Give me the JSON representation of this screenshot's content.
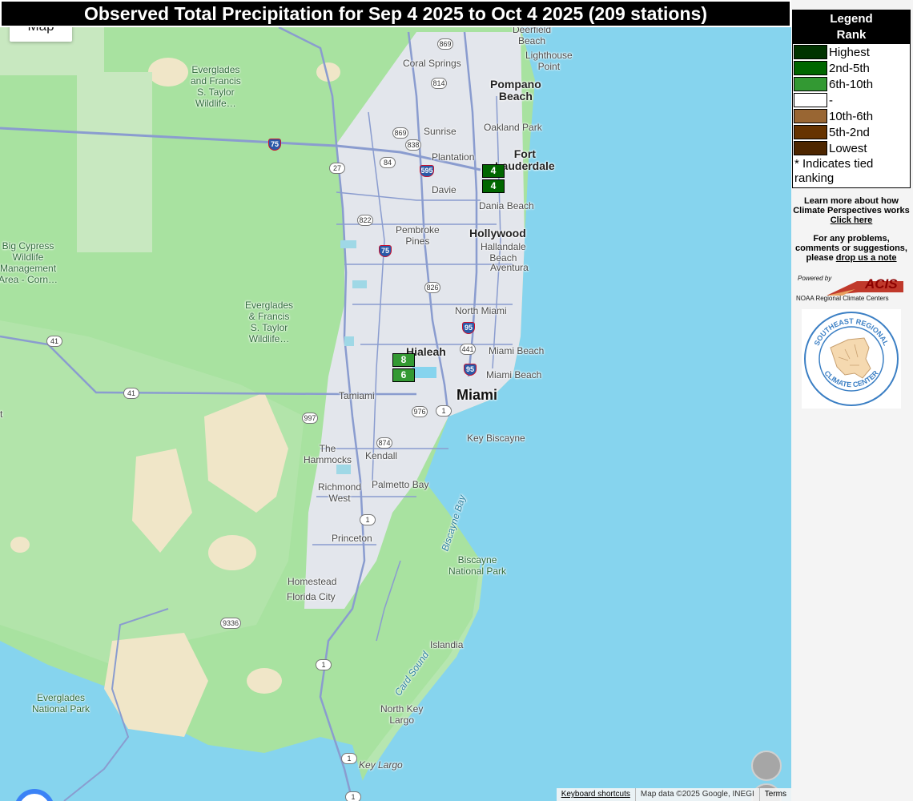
{
  "map": {
    "title": "Observed Total Precipitation for Sep 4 2025 to Oct 4 2025 (209 stations)",
    "map_type_button": "Map",
    "places": [
      {
        "id": "everglades-taylor-1",
        "label": "Everglades\nand Francis\nS. Taylor\nWildlife…",
        "kind": "green"
      },
      {
        "id": "everglades-taylor-2",
        "label": "Everglades\n& Francis\nS. Taylor\nWildlife…",
        "kind": "green"
      },
      {
        "id": "big-cypress",
        "label": "Big Cypress\nWildlife\nManagement\nArea - Corn…",
        "kind": "green"
      },
      {
        "id": "everglades-np",
        "label": "Everglades\nNational Park",
        "kind": "green"
      },
      {
        "id": "biscayne-np",
        "label": "Biscayne\nNational Park",
        "kind": "green"
      },
      {
        "id": "deerfield",
        "label": "Deerfield\nBeach",
        "kind": "normal"
      },
      {
        "id": "lighthouse-point",
        "label": "Lighthouse\nPoint",
        "kind": "normal"
      },
      {
        "id": "coral-springs",
        "label": "Coral Springs",
        "kind": "normal"
      },
      {
        "id": "pompano",
        "label": "Pompano\nBeach",
        "kind": "city"
      },
      {
        "id": "oakland-park",
        "label": "Oakland Park",
        "kind": "normal"
      },
      {
        "id": "sunrise",
        "label": "Sunrise",
        "kind": "normal"
      },
      {
        "id": "plantation",
        "label": "Plantation",
        "kind": "normal"
      },
      {
        "id": "fort-lauderdale",
        "label": "Fort\nLauderdale",
        "kind": "city"
      },
      {
        "id": "davie",
        "label": "Davie",
        "kind": "normal"
      },
      {
        "id": "dania",
        "label": "Dania Beach",
        "kind": "normal"
      },
      {
        "id": "pembroke",
        "label": "Pembroke\nPines",
        "kind": "normal"
      },
      {
        "id": "hollywood",
        "label": "Hollywood",
        "kind": "city"
      },
      {
        "id": "hallandale",
        "label": "Hallandale\nBeach",
        "kind": "normal"
      },
      {
        "id": "aventura",
        "label": "Aventura",
        "kind": "normal"
      },
      {
        "id": "north-miami",
        "label": "North Miami",
        "kind": "normal"
      },
      {
        "id": "hialeah",
        "label": "Hialeah",
        "kind": "city"
      },
      {
        "id": "miami-beach-1",
        "label": "Miami Beach",
        "kind": "normal"
      },
      {
        "id": "miami-beach-2",
        "label": "Miami Beach",
        "kind": "normal"
      },
      {
        "id": "miami",
        "label": "Miami",
        "kind": "big"
      },
      {
        "id": "tamiami",
        "label": "Tamiami",
        "kind": "normal"
      },
      {
        "id": "key-biscayne",
        "label": "Key Biscayne",
        "kind": "normal"
      },
      {
        "id": "the-hammocks",
        "label": "The\nHammocks",
        "kind": "normal"
      },
      {
        "id": "kendall",
        "label": "Kendall",
        "kind": "normal"
      },
      {
        "id": "richmond-west",
        "label": "Richmond\nWest",
        "kind": "normal"
      },
      {
        "id": "palmetto-bay",
        "label": "Palmetto Bay",
        "kind": "normal"
      },
      {
        "id": "princeton",
        "label": "Princeton",
        "kind": "normal"
      },
      {
        "id": "homestead",
        "label": "Homestead",
        "kind": "normal"
      },
      {
        "id": "florida-city",
        "label": "Florida City",
        "kind": "normal"
      },
      {
        "id": "islandia",
        "label": "Islandia",
        "kind": "normal"
      },
      {
        "id": "north-key-largo",
        "label": "North Key\nLargo",
        "kind": "normal"
      },
      {
        "id": "key-largo",
        "label": "Key Largo",
        "kind": "water-i"
      },
      {
        "id": "biscayne-bay",
        "label": "Biscayne Bay",
        "kind": "water"
      },
      {
        "id": "card-sound",
        "label": "Card Sound",
        "kind": "water"
      },
      {
        "id": "edge-t",
        "label": "t",
        "kind": "normal"
      }
    ],
    "shields": [
      "869",
      "814",
      "869",
      "838",
      "84",
      "27",
      "822",
      "826",
      "441",
      "997",
      "976",
      "874",
      "1",
      "1",
      "1",
      "1",
      "1",
      "9336",
      "41",
      "41"
    ],
    "interstate_shields": [
      "75",
      "595",
      "75",
      "95",
      "95"
    ],
    "markers": [
      {
        "id": "marker-fll-1",
        "rank": "4",
        "category": "2nd-5th",
        "color": "#006600"
      },
      {
        "id": "marker-fll-2",
        "rank": "4",
        "category": "2nd-5th",
        "color": "#006600"
      },
      {
        "id": "marker-hialeah-1",
        "rank": "8",
        "category": "6th-10th",
        "color": "#339933"
      },
      {
        "id": "marker-hialeah-2",
        "rank": "6",
        "category": "6th-10th",
        "color": "#339933"
      }
    ],
    "attribution": {
      "shortcuts": "Keyboard shortcuts",
      "data": "Map data ©2025 Google, INEGI",
      "terms": "Terms"
    }
  },
  "legend": {
    "title_line1": "Legend",
    "title_line2": "Rank",
    "rows": [
      {
        "label": "Highest",
        "color": "#003300"
      },
      {
        "label": "2nd-5th",
        "color": "#006600"
      },
      {
        "label": "6th-10th",
        "color": "#339933"
      },
      {
        "label": "-",
        "color": "#ffffff"
      },
      {
        "label": "10th-6th",
        "color": "#996633"
      },
      {
        "label": "5th-2nd",
        "color": "#663300"
      },
      {
        "label": "Lowest",
        "color": "#4d2600"
      }
    ],
    "note": "* Indicates tied ranking"
  },
  "panel": {
    "learn_line1": "Learn more about how",
    "learn_line2": "Climate Perspectives works",
    "learn_link": "Click here",
    "problems_line1": "For any problems,",
    "problems_line2": "comments or suggestions,",
    "problems_line3_prefix": "please",
    "problems_link": "drop us a note",
    "acis_powered": "Powered by",
    "acis_name": "ACIS",
    "acis_sub": "NOAA Regional Climate Centers",
    "srcc_top": "SOUTHEAST REGIONAL",
    "srcc_bottom": "CLIMATE CENTER"
  }
}
